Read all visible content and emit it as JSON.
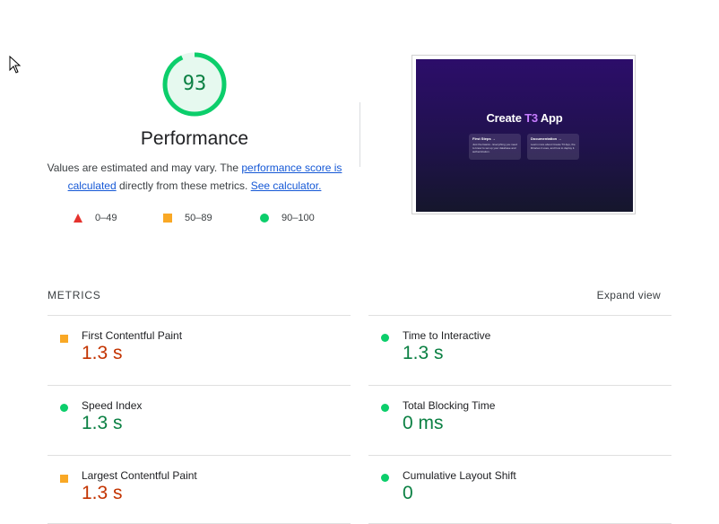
{
  "cursor": {
    "icon": "mouse-pointer-icon"
  },
  "gauge": {
    "score": "93",
    "score_fraction": 0.93,
    "title": "Performance",
    "color": "#0cce6b",
    "track_color": "#e6f9ef"
  },
  "description": {
    "prefix": "Values are estimated and may vary. The ",
    "link_score": "performance score is calculated",
    "middle": " directly from these metrics. ",
    "link_calculator": "See calculator."
  },
  "legend": {
    "fail": {
      "label": "0–49",
      "icon": "red-triangle-icon",
      "color": "#e5322d"
    },
    "average": {
      "label": "50–89",
      "icon": "orange-square-icon",
      "color": "#f9a825"
    },
    "pass": {
      "label": "90–100",
      "icon": "green-circle-icon",
      "color": "#0cce6b"
    }
  },
  "thumbnail": {
    "title_prefix": "Create ",
    "title_accent": "T3",
    "title_suffix": " App",
    "cards": [
      {
        "title": "First Steps →",
        "body": "Just the basics - Everything you need to know to set up your database and authentication."
      },
      {
        "title": "Documentation →",
        "body": "Learn more about Create T3 App, the libraries it uses, and how to deploy it."
      }
    ]
  },
  "metrics": {
    "header": "METRICS",
    "expand_label": "Expand view",
    "items": [
      {
        "label": "First Contentful Paint",
        "value": "1.3 s",
        "status": "average"
      },
      {
        "label": "Time to Interactive",
        "value": "1.3 s",
        "status": "pass"
      },
      {
        "label": "Speed Index",
        "value": "1.3 s",
        "status": "pass"
      },
      {
        "label": "Total Blocking Time",
        "value": "0 ms",
        "status": "pass"
      },
      {
        "label": "Largest Contentful Paint",
        "value": "1.3 s",
        "status": "average"
      },
      {
        "label": "Cumulative Layout Shift",
        "value": "0",
        "status": "pass"
      }
    ]
  },
  "colors": {
    "average_value": "#c33300",
    "pass_value": "#0b8043",
    "link": "#1558d6"
  }
}
